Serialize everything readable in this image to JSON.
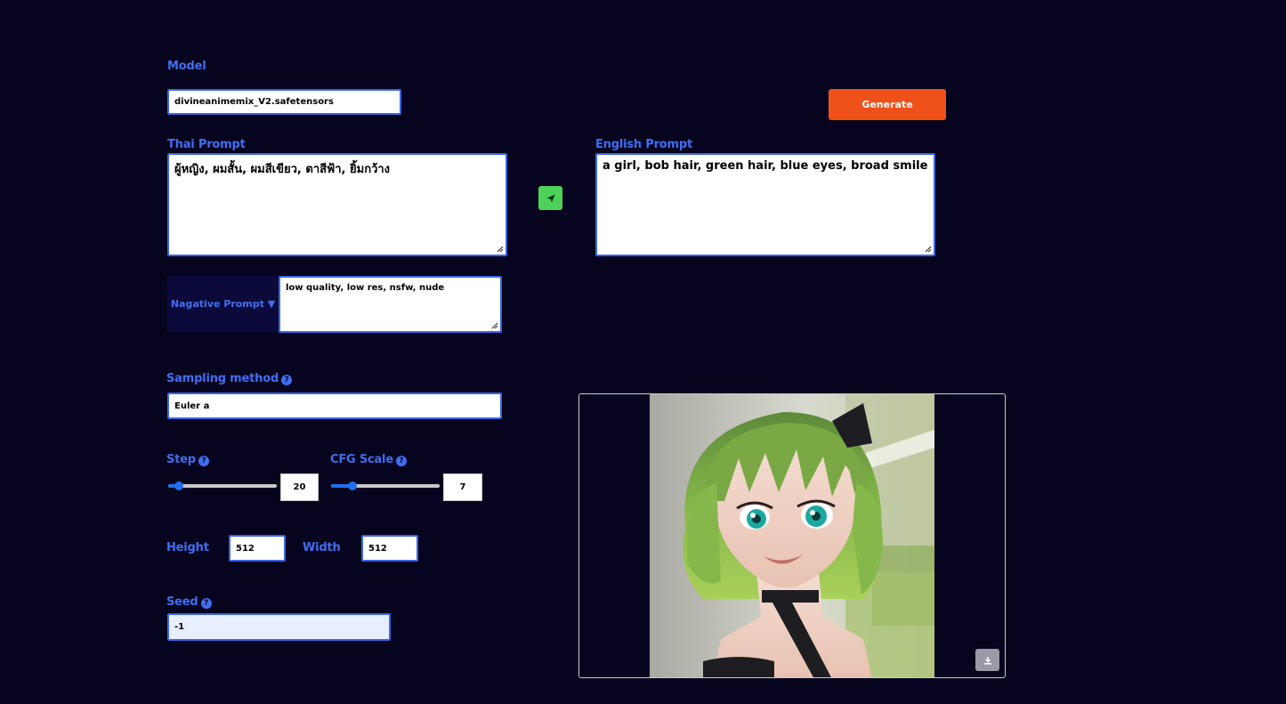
{
  "model": {
    "label": "Model",
    "value": "divineanimemix_V2.safetensors"
  },
  "generate_label": "Generate",
  "thai_prompt": {
    "label": "Thai Prompt",
    "value": "ผู้หญิง, ผมสั้น, ผมสีเขียว, ตาสีฟ้า, ยิ้มกว้าง"
  },
  "english_prompt": {
    "label": "English Prompt",
    "value": "a girl, bob hair, green hair, blue eyes, broad smile"
  },
  "negative_prompt": {
    "label": "Nagative Prompt ▼",
    "value": "low quality, low res, nsfw, nude"
  },
  "sampling": {
    "label": "Sampling method",
    "value": "Euler a"
  },
  "step": {
    "label": "Step",
    "value": "20",
    "fraction": 0.1
  },
  "cfg": {
    "label": "CFG Scale",
    "value": "7",
    "fraction": 0.2
  },
  "height": {
    "label": "Height",
    "value": "512"
  },
  "width": {
    "label": "Width",
    "value": "512"
  },
  "seed": {
    "label": "Seed",
    "value": "-1"
  },
  "icons": {
    "send": "paper-plane-icon",
    "help": "question-circle-icon",
    "download": "download-icon"
  },
  "colors": {
    "background": "#06041e",
    "accent": "#3f6ef2",
    "generate": "#f0501a",
    "send": "#4cd15a"
  }
}
